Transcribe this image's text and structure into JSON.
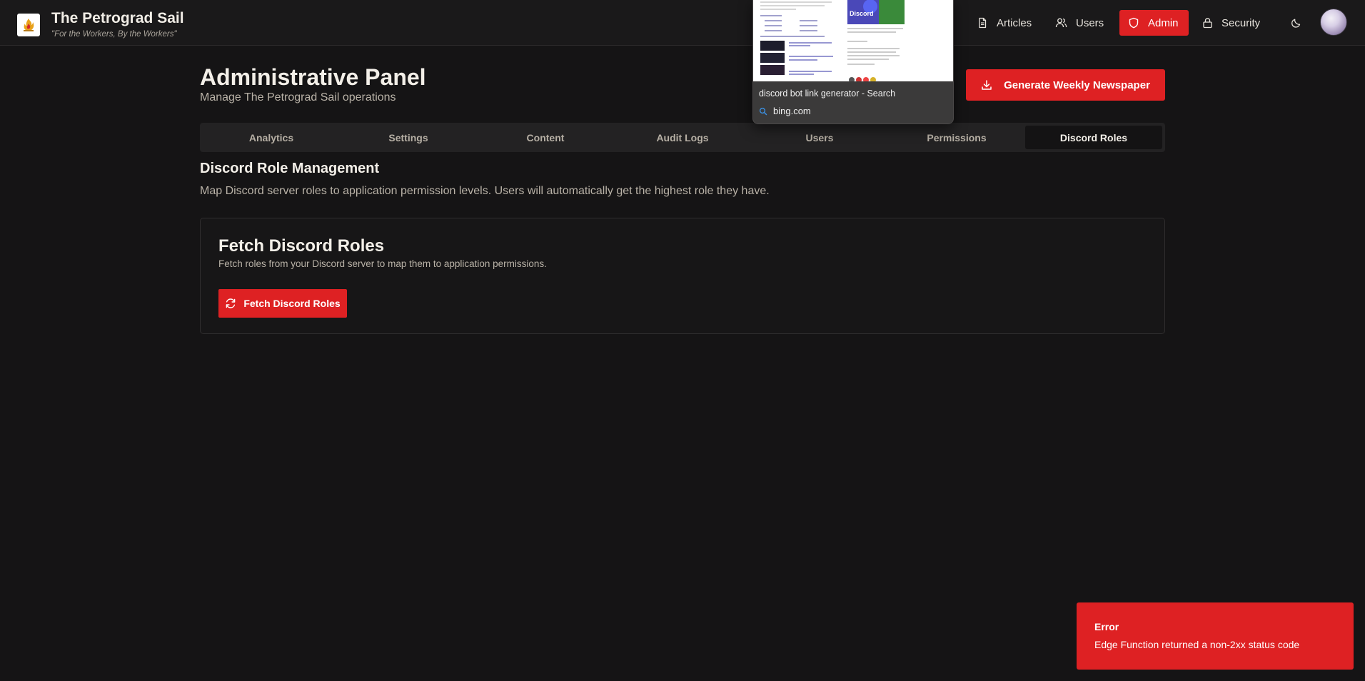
{
  "brand": {
    "title": "The Petrograd Sail",
    "tagline": "\"For the Workers, By the Workers\""
  },
  "nav": {
    "articles": "Articles",
    "users": "Users",
    "admin": "Admin",
    "security": "Security"
  },
  "tab_preview": {
    "title": "discord bot link generator - Search",
    "url": "bing.com",
    "thumbnail_label": "Discord"
  },
  "page": {
    "title": "Administrative Panel",
    "subtitle": "Manage The Petrograd Sail operations",
    "generate_button": "Generate Weekly Newspaper"
  },
  "tabs": [
    {
      "label": "Analytics",
      "active": false
    },
    {
      "label": "Settings",
      "active": false
    },
    {
      "label": "Content",
      "active": false
    },
    {
      "label": "Audit Logs",
      "active": false
    },
    {
      "label": "Users",
      "active": false
    },
    {
      "label": "Permissions",
      "active": false
    },
    {
      "label": "Discord Roles",
      "active": true
    }
  ],
  "section": {
    "title": "Discord Role Management",
    "description": "Map Discord server roles to application permission levels. Users will automatically get the highest role they have."
  },
  "card": {
    "title": "Fetch Discord Roles",
    "description": "Fetch roles from your Discord server to map them to application permissions.",
    "button": "Fetch Discord Roles"
  },
  "toast": {
    "title": "Error",
    "message": "Edge Function returned a non-2xx status code"
  },
  "colors": {
    "accent": "#de2123",
    "background": "#151415",
    "card_border": "#302e2f"
  }
}
